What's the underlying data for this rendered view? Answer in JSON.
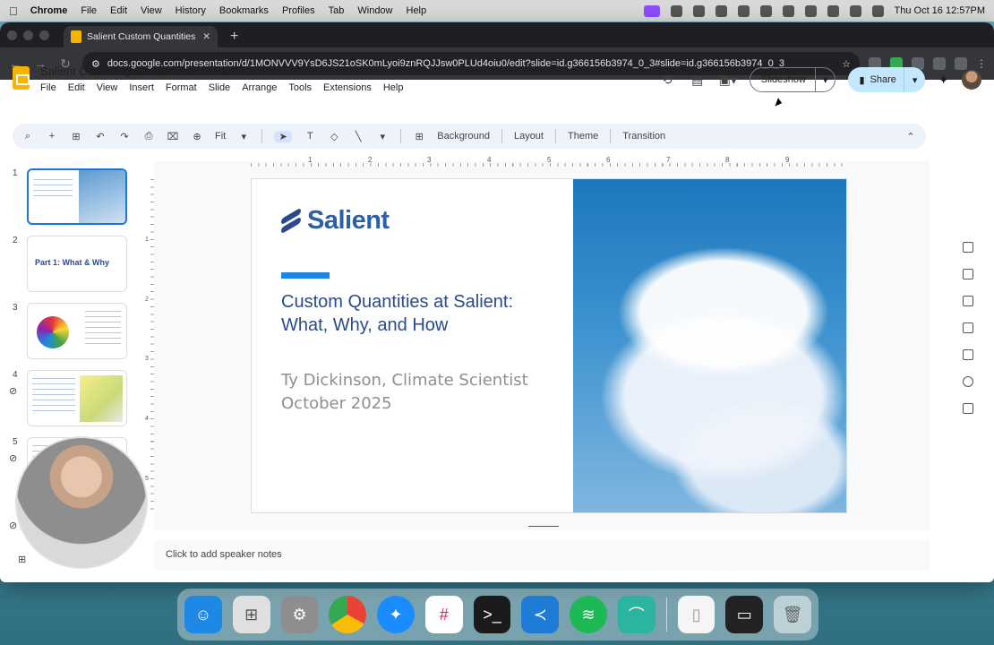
{
  "menubar": {
    "app": "Chrome",
    "items": [
      "File",
      "Edit",
      "View",
      "History",
      "Bookmarks",
      "Profiles",
      "Tab",
      "Window",
      "Help"
    ],
    "clock": "Thu Oct 16  12:57PM"
  },
  "browser": {
    "tab_title": "Salient Custom Quantities - G",
    "url": "docs.google.com/presentation/d/1MONVVV9YsD6JS21oSK0mLyoi9znRQJJsw0PLUd4oiu0/edit?slide=id.g366156b3974_0_3#slide=id.g366156b3974_0_3"
  },
  "app": {
    "doc_title": "Salient Custom Quantities",
    "menus": [
      "File",
      "Edit",
      "View",
      "Insert",
      "Format",
      "Slide",
      "Arrange",
      "Tools",
      "Extensions",
      "Help"
    ],
    "slideshow_label": "Slideshow",
    "share_label": "Share"
  },
  "toolbar": {
    "zoom": "Fit",
    "background": "Background",
    "layout": "Layout",
    "theme": "Theme",
    "transition": "Transition"
  },
  "ruler": {
    "h": [
      "1",
      "2",
      "3",
      "4",
      "5",
      "6",
      "7",
      "8",
      "9"
    ],
    "v": [
      "1",
      "2",
      "3",
      "4",
      "5"
    ]
  },
  "filmstrip": {
    "slides": [
      {
        "num": "1",
        "label": ""
      },
      {
        "num": "2",
        "label": "Part 1: What & Why"
      },
      {
        "num": "3",
        "label": ""
      },
      {
        "num": "4",
        "label": ""
      },
      {
        "num": "5",
        "label": ""
      }
    ]
  },
  "slide": {
    "logo_text": "Salient",
    "title_line1": "Custom Quantities at Salient:",
    "title_line2": "What, Why, and How",
    "author": "Ty Dickinson, Climate Scientist",
    "date": "October 2025"
  },
  "notes": {
    "placeholder": "Click to add speaker notes"
  },
  "colors": {
    "brand_blue": "#2c5fa8",
    "accent_bar": "#1a85e2",
    "share_bg": "#c2e7ff",
    "selection": "#1a73e8"
  },
  "dock": {
    "apps": [
      "finder",
      "launchpad",
      "settings",
      "chrome",
      "safari",
      "slack",
      "terminal",
      "vscode",
      "spotify",
      "app",
      "file",
      "screen",
      "trash"
    ]
  }
}
